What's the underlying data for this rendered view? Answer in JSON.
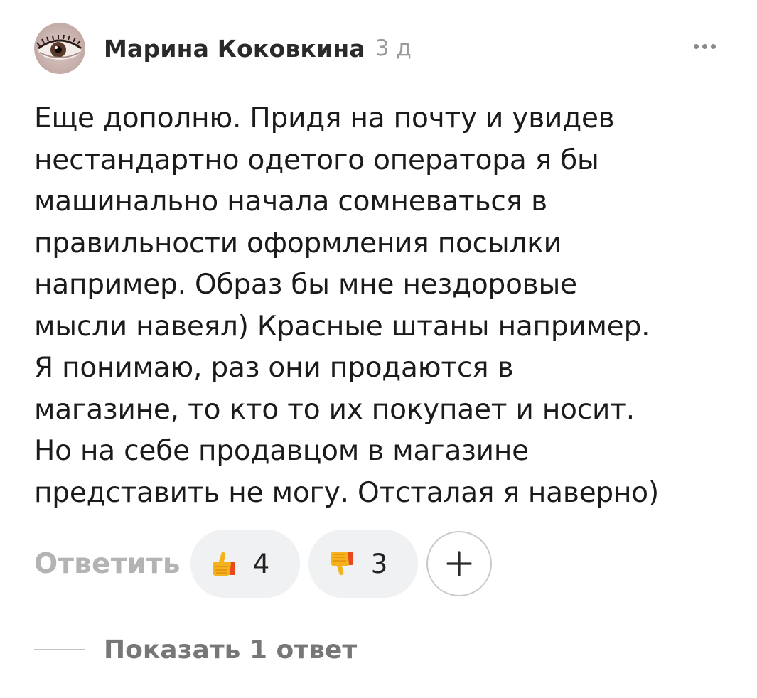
{
  "comment": {
    "author": "Марина Коковкина",
    "time": "3 д",
    "text_lines": [
      "Еще дополню. Придя на почту и увидев",
      "нестандартно одетого оператора я бы",
      "машинально начала сомневаться в",
      "правильности оформления посылки",
      "например. Образ бы мне нездоровые",
      "мысли навеял) Красные штаны например.",
      "Я понимаю, раз они продаются в",
      "магазине, то кто то их покупает и носит.",
      "Но на себе продавцом в магазине",
      "представить не могу. Отсталая я наверно)"
    ],
    "avatar_icon": "eye-avatar",
    "more_icon": "more-dots-icon"
  },
  "actions": {
    "reply_label": "Ответить",
    "likes": {
      "icon": "thumbs-up-emoji",
      "count": "4"
    },
    "dislikes": {
      "icon": "thumbs-down-emoji",
      "count": "3"
    },
    "add_reaction_icon": "plus-icon"
  },
  "replies": {
    "show_label": "Показать 1 ответ"
  },
  "colors": {
    "author": "#2a2a2a",
    "time": "#9a9a9a",
    "reply": "#b3b3b3",
    "pill_bg": "#f0f1f3",
    "show_replies": "#777777"
  }
}
